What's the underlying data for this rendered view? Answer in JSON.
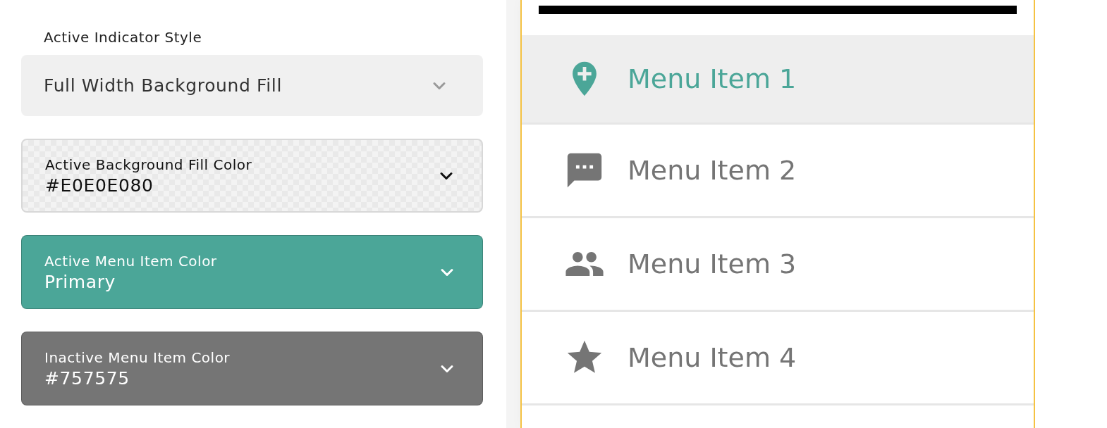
{
  "settings": {
    "label": "Active Indicator Style",
    "dropdowns": [
      {
        "kind": "select",
        "value": "Full Width Background Fill"
      },
      {
        "kind": "checker",
        "label": "Active Background Fill Color",
        "value": "#E0E0E080"
      },
      {
        "kind": "color",
        "label": "Active Menu Item Color",
        "value": "Primary",
        "color": "#4ba698"
      },
      {
        "kind": "color",
        "label": "Inactive Menu Item Color",
        "value": "#757575",
        "color": "#757575"
      }
    ]
  },
  "preview": {
    "menu_items": [
      {
        "label": "Menu Item 1",
        "selected": true
      },
      {
        "label": "Menu Item 2",
        "selected": false
      },
      {
        "label": "Menu Item 3",
        "selected": false
      },
      {
        "label": "Menu Item 4",
        "selected": false
      }
    ]
  }
}
